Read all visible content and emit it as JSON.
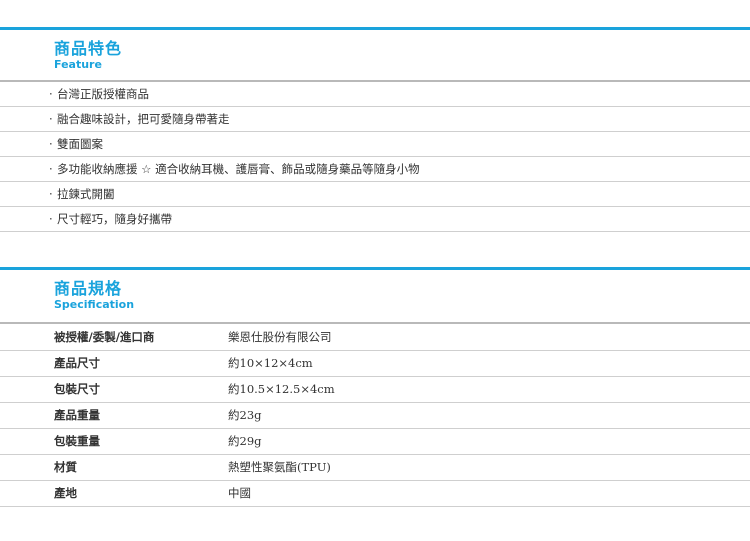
{
  "feature": {
    "title_zh": "商品特色",
    "title_en": "Feature",
    "bullet": "·",
    "items": [
      "台灣正版授權商品",
      "融合趣味設計，把可愛隨身帶著走",
      "雙面圖案",
      "多功能收納應援 ☆ 適合收納耳機、護唇膏、飾品或隨身藥品等隨身小物",
      "拉鍊式開闔",
      "尺寸輕巧，隨身好攜帶"
    ]
  },
  "spec": {
    "title_zh": "商品規格",
    "title_en": "Specification",
    "rows": [
      {
        "key": "被授權/委製/進口商",
        "value": "樂恩仕股份有限公司"
      },
      {
        "key": "產品尺寸",
        "value": "約10×12×4cm"
      },
      {
        "key": "包裝尺寸",
        "value": "約10.5×12.5×4cm"
      },
      {
        "key": "產品重量",
        "value": "約23g"
      },
      {
        "key": "包裝重量",
        "value": "約29g"
      },
      {
        "key": "材質",
        "value": "熱塑性聚氨酯(TPU)"
      },
      {
        "key": "產地",
        "value": "中國"
      }
    ]
  },
  "colors": {
    "accent": "#1aa3dc",
    "rule": "#b9b9b9",
    "divider": "#cfcfcf",
    "text": "#333333"
  }
}
